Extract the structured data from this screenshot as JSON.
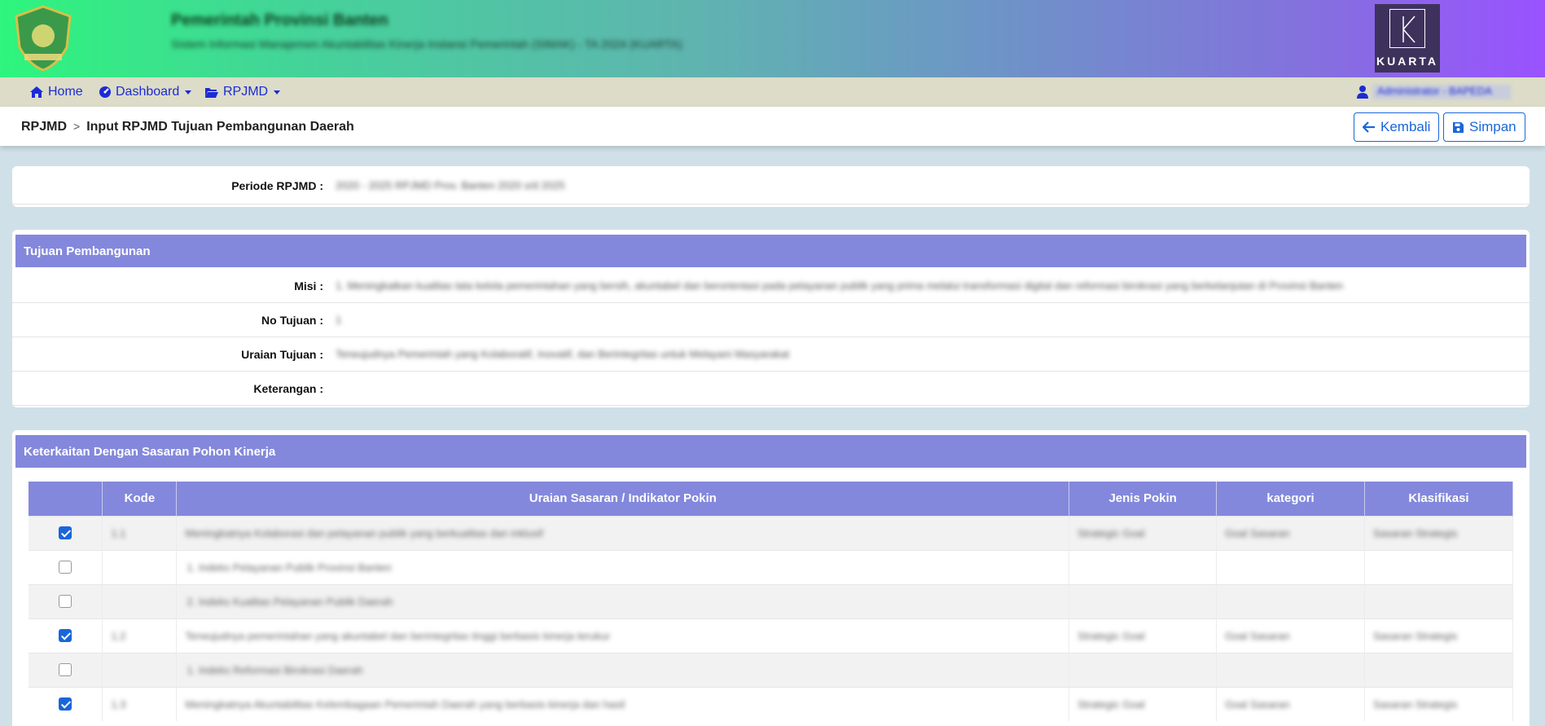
{
  "header": {
    "site_title": "Pemerintah Provinsi Banten",
    "site_subtitle": "Sistem Informasi Manajemen Akuntabilitas Kinerja Instansi Pemerintah (SIMAK) - TA 2024 (KUARTA)",
    "brand_logo_text": "KUARTA"
  },
  "nav": {
    "home": "Home",
    "dashboard": "Dashboard",
    "rpjmd": "RPJMD",
    "user": "Administrator - BAPEDA"
  },
  "breadcrumb": {
    "root": "RPJMD",
    "separator": ">",
    "current": "Input RPJMD Tujuan Pembangunan Daerah"
  },
  "buttons": {
    "back": "Kembali",
    "save": "Simpan"
  },
  "periode": {
    "label": "Periode RPJMD :",
    "value": "2020 - 2025 RPJMD Prov. Banten 2020 s/d 2025"
  },
  "tujuan": {
    "title": "Tujuan Pembangunan",
    "misi_label": "Misi :",
    "misi_value": "1. Meningkatkan kualitas tata kelola pemerintahan yang bersih, akuntabel dan berorientasi pada pelayanan publik yang prima melalui transformasi digital dan reformasi birokrasi yang berkelanjutan di Provinsi Banten",
    "no_label": "No Tujuan :",
    "no_value": "1",
    "uraian_label": "Uraian Tujuan :",
    "uraian_value": "Terwujudnya Pemerintah yang Kolaboratif, Inovatif, dan Berintegritas untuk Melayani Masyarakat",
    "ket_label": "Keterangan :",
    "ket_value": ""
  },
  "keterkaitan": {
    "title": "Keterkaitan Dengan Sasaran Pohon Kinerja",
    "columns": [
      "",
      "Kode",
      "Uraian Sasaran / Indikator Pokin",
      "Jenis Pokin",
      "kategori",
      "Klasifikasi"
    ],
    "rows": [
      {
        "checked": true,
        "kode": "1.1",
        "uraian": "Meningkatnya Kolaborasi dan pelayanan publik yang berkualitas dan inklusif",
        "jenis": "Strategic Goal",
        "kategori": "Goal Sasaran",
        "klasifikasi": "Sasaran Strategis"
      },
      {
        "checked": false,
        "kode": "",
        "uraian": "1. Indeks Pelayanan Publik Provinsi Banten",
        "jenis": "",
        "kategori": "",
        "klasifikasi": ""
      },
      {
        "checked": false,
        "kode": "",
        "uraian": "2. Indeks Kualitas Pelayanan Publik Daerah",
        "jenis": "",
        "kategori": "",
        "klasifikasi": ""
      },
      {
        "checked": true,
        "kode": "1.2",
        "uraian": "Terwujudnya pemerintahan yang akuntabel dan berintegritas tinggi berbasis kinerja terukur",
        "jenis": "Strategic Goal",
        "kategori": "Goal Sasaran",
        "klasifikasi": "Sasaran Strategis"
      },
      {
        "checked": false,
        "kode": "",
        "uraian": "1. Indeks Reformasi Birokrasi Daerah",
        "jenis": "",
        "kategori": "",
        "klasifikasi": ""
      },
      {
        "checked": true,
        "kode": "1.3",
        "uraian": "Meningkatnya Akuntabilitas Kelembagaan Pemerintah Daerah yang berbasis kinerja dan hasil",
        "jenis": "Strategic Goal",
        "kategori": "Goal Sasaran",
        "klasifikasi": "Sasaran Strategis"
      }
    ]
  },
  "colors": {
    "accent": "#8388dc",
    "link": "#1b2bd6",
    "primary": "#1a66d9",
    "nav_bg": "#dcdcc8"
  }
}
